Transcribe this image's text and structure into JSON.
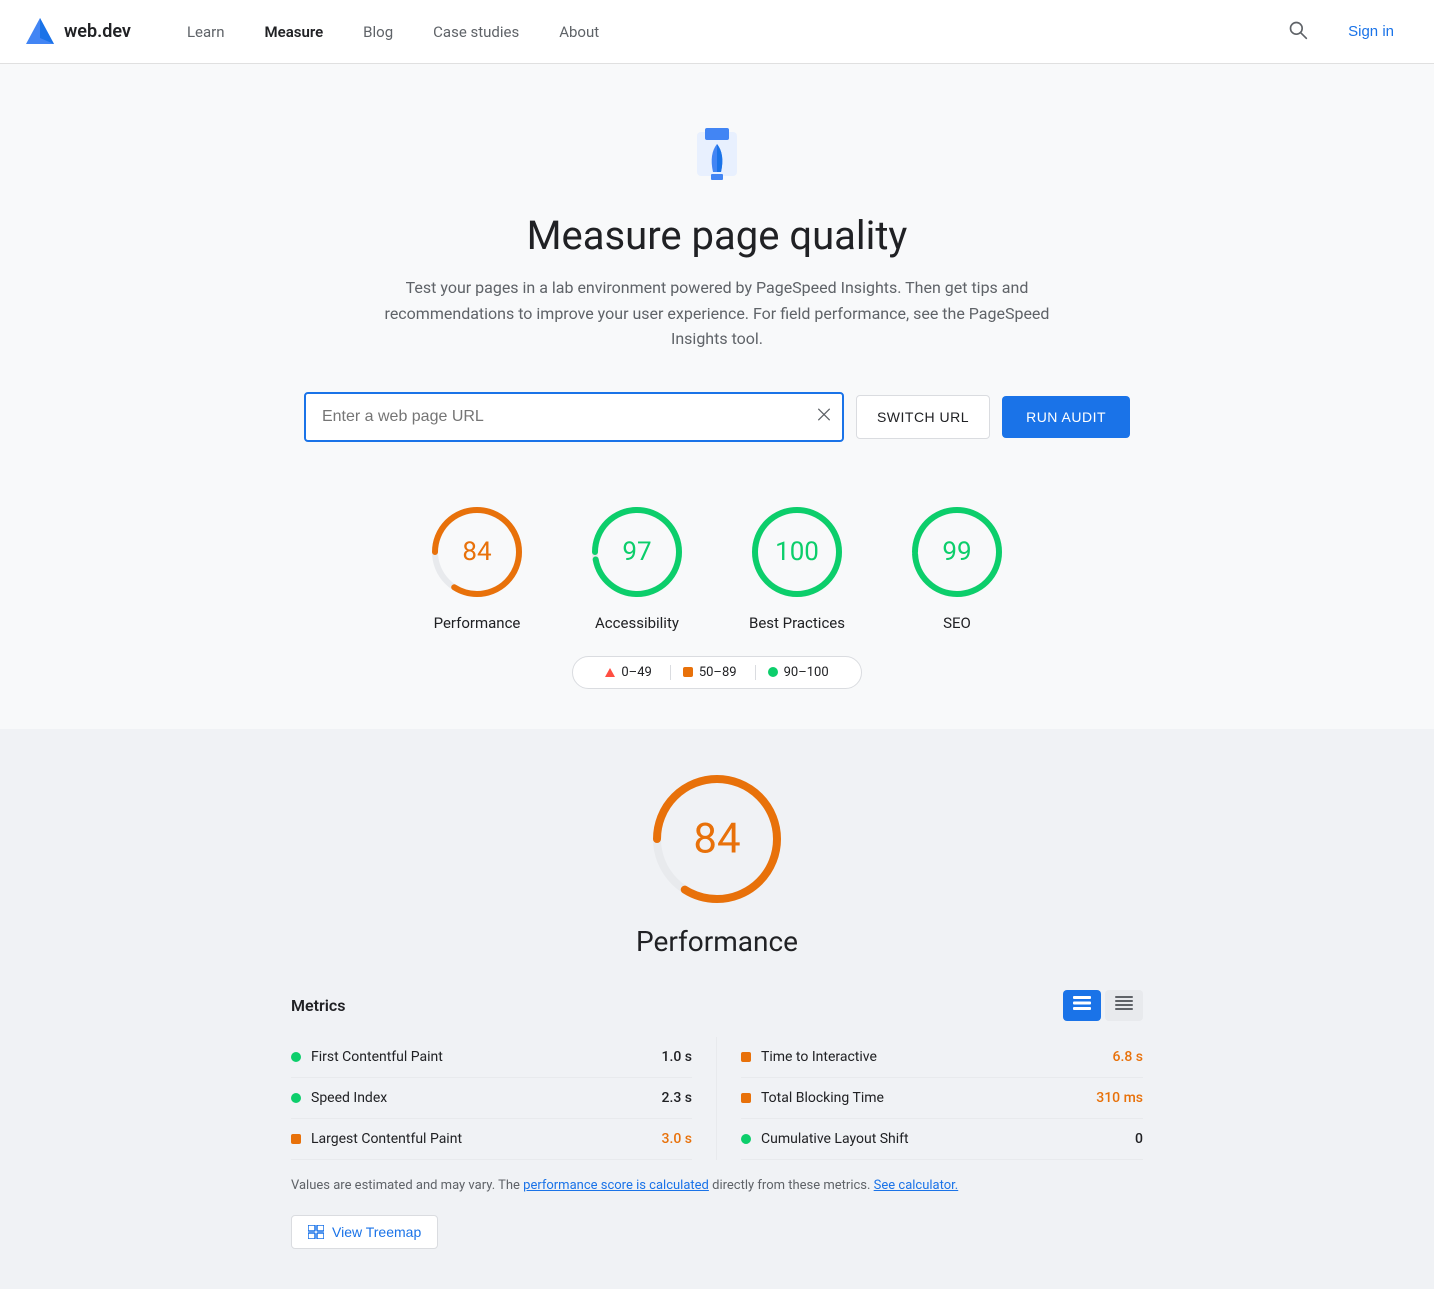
{
  "nav": {
    "logo_text": "web.dev",
    "links": [
      {
        "label": "Learn",
        "active": false
      },
      {
        "label": "Measure",
        "active": true
      },
      {
        "label": "Blog",
        "active": false
      },
      {
        "label": "Case studies",
        "active": false
      },
      {
        "label": "About",
        "active": false
      }
    ],
    "sign_in_label": "Sign in"
  },
  "hero": {
    "title": "Measure page quality",
    "subtitle": "Test your pages in a lab environment powered by PageSpeed Insights. Then get tips and recommendations to improve your user experience. For field performance, see the PageSpeed Insights tool."
  },
  "url_bar": {
    "placeholder": "Enter a web page URL",
    "switch_url_label": "SWITCH URL",
    "run_audit_label": "RUN AUDIT"
  },
  "scores": [
    {
      "value": 84,
      "label": "Performance",
      "color": "#e8710a",
      "pct": 84
    },
    {
      "value": 97,
      "label": "Accessibility",
      "color": "#0cce6b",
      "pct": 97
    },
    {
      "value": 100,
      "label": "Best Practices",
      "color": "#0cce6b",
      "pct": 100
    },
    {
      "value": 99,
      "label": "SEO",
      "color": "#0cce6b",
      "pct": 99
    }
  ],
  "legend": [
    {
      "shape": "triangle",
      "color": "#ff4e42",
      "range": "0–49"
    },
    {
      "shape": "square",
      "color": "#e8710a",
      "range": "50–89"
    },
    {
      "shape": "dot",
      "color": "#0cce6b",
      "range": "90–100"
    }
  ],
  "performance": {
    "score": 84,
    "score_color": "#e8710a",
    "title": "Performance",
    "metrics_title": "Metrics",
    "metrics": [
      {
        "name": "First Contentful Paint",
        "value": "1.0 s",
        "color": "#0cce6b",
        "shape": "dot",
        "value_color": "#202124"
      },
      {
        "name": "Speed Index",
        "value": "2.3 s",
        "color": "#0cce6b",
        "shape": "dot",
        "value_color": "#202124"
      },
      {
        "name": "Largest Contentful Paint",
        "value": "3.0 s",
        "color": "#e8710a",
        "shape": "square",
        "value_color": "#e8710a"
      },
      {
        "name": "Time to Interactive",
        "value": "6.8 s",
        "color": "#e8710a",
        "shape": "square",
        "value_color": "#e8710a"
      },
      {
        "name": "Total Blocking Time",
        "value": "310 ms",
        "color": "#e8710a",
        "shape": "square",
        "value_color": "#e8710a"
      },
      {
        "name": "Cumulative Layout Shift",
        "value": "0",
        "color": "#0cce6b",
        "shape": "dot",
        "value_color": "#202124"
      }
    ],
    "note_text": "Values are estimated and may vary. The ",
    "note_link1": "performance score is calculated",
    "note_mid": " directly from these metrics. ",
    "note_link2": "See calculator.",
    "treemap_label": "View Treemap"
  }
}
